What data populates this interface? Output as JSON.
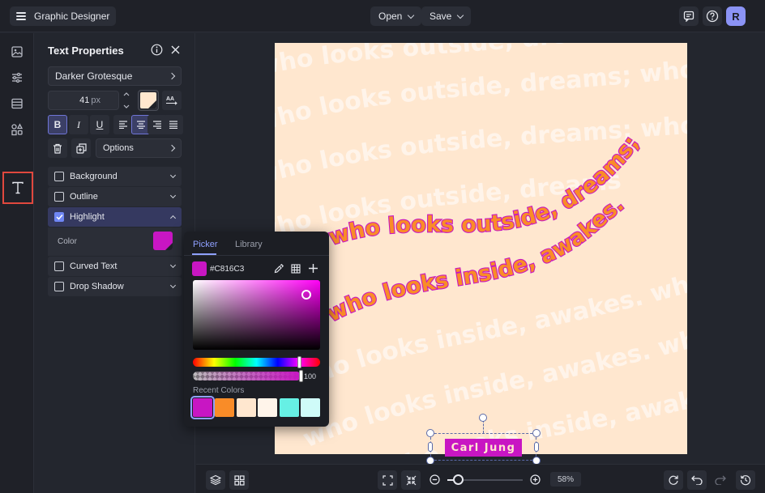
{
  "topbar": {
    "app_title": "Graphic Designer",
    "open_label": "Open",
    "save_label": "Save",
    "avatar_initial": "R"
  },
  "rail": {
    "items": [
      "image-icon",
      "sliders-icon",
      "background-icon",
      "elements-icon",
      "text-icon"
    ],
    "active": "text-icon"
  },
  "panel": {
    "title": "Text Properties",
    "font_name": "Darker Grotesque",
    "font_size": "41",
    "font_size_unit": "px",
    "text_color": "#FFE7CF",
    "options_label": "Options",
    "sections": [
      {
        "label": "Background",
        "checked": false
      },
      {
        "label": "Outline",
        "checked": false
      },
      {
        "label": "Highlight",
        "checked": true,
        "expanded": true
      },
      {
        "label": "Curved Text",
        "checked": false
      },
      {
        "label": "Drop Shadow",
        "checked": false
      }
    ],
    "highlight_color_label": "Color",
    "highlight_color": "#C816C3"
  },
  "picker": {
    "tab_picker": "Picker",
    "tab_library": "Library",
    "hex_value": "#C816C3",
    "alpha_value": "100",
    "recent_label": "Recent Colors",
    "recent_colors": [
      "#C816C3",
      "#F98C28",
      "#FFE7CF",
      "#FFF4EA",
      "#66F0E4",
      "#CFFBF8"
    ]
  },
  "canvas": {
    "bg_text_lines": [
      "who looks outside, dreams; who looks outside, dreams;",
      "who looks outside, dreams; who looks outside, dreams;",
      "who looks outside, dreams; who looks outside, dreams;",
      "who looks outside, dreams; who looks",
      "who looks inside, awakes. who looks inside, awakes.",
      "who looks inside, awakes. who looks inside, awakes.",
      "who looks inside, awakes. who looks inside, awakes."
    ],
    "headline_line1": "who looks outside, dreams;",
    "headline_line2": "who looks inside, awakes.",
    "signature": "Carl Jung",
    "colors": {
      "artboard": "#FFE7CF",
      "text_fill": "#F98C28",
      "text_stroke": "#C816C3",
      "bg_text": "#FFF4EA"
    }
  },
  "bottombar": {
    "zoom": "58%"
  }
}
